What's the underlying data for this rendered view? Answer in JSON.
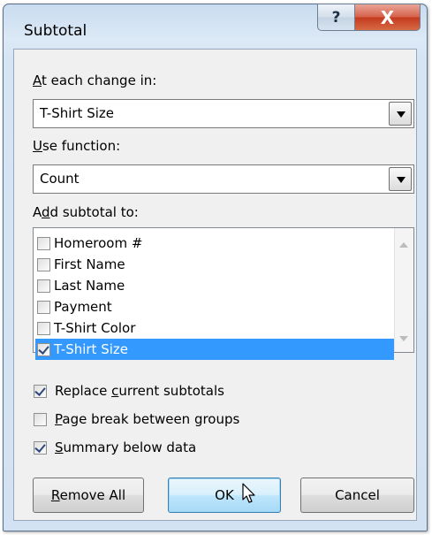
{
  "window": {
    "title": "Subtotal",
    "help_glyph": "?",
    "close_glyph": "X"
  },
  "change_in": {
    "label_accel": "A",
    "label_rest": "t each change in:",
    "value": "T-Shirt Size"
  },
  "use_function": {
    "label_accel": "U",
    "label_rest": "se function:",
    "value": "Count"
  },
  "add_subtotal": {
    "label_pre": "A",
    "label_accel": "d",
    "label_post": "d subtotal to:",
    "items": [
      {
        "label": "Homeroom #",
        "checked": false,
        "selected": false
      },
      {
        "label": "First Name",
        "checked": false,
        "selected": false
      },
      {
        "label": "Last Name",
        "checked": false,
        "selected": false
      },
      {
        "label": "Payment",
        "checked": false,
        "selected": false
      },
      {
        "label": "T-Shirt Color",
        "checked": false,
        "selected": false
      },
      {
        "label": "T-Shirt Size",
        "checked": true,
        "selected": true
      }
    ]
  },
  "options": {
    "replace": {
      "pre": "Replace ",
      "accel": "c",
      "post": "urrent subtotals",
      "checked": true
    },
    "page_break": {
      "pre": "",
      "accel": "P",
      "post": "age break between groups",
      "checked": false
    },
    "summary": {
      "pre": "",
      "accel": "S",
      "post": "ummary below data",
      "checked": true
    }
  },
  "buttons": {
    "remove_all": {
      "accel": "R",
      "rest": "emove All"
    },
    "ok": "OK",
    "cancel": "Cancel"
  },
  "colors": {
    "selection": "#3399ff",
    "close_button": "#c43b1f",
    "dialog_frame": "#d6e5f4"
  }
}
